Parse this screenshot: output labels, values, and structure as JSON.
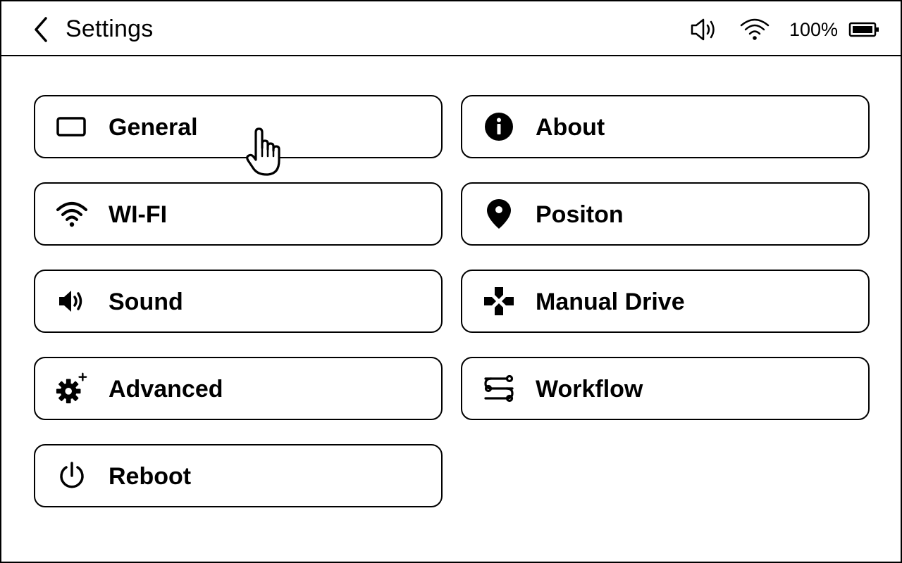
{
  "header": {
    "title": "Settings",
    "back_icon": "chevron-left-icon"
  },
  "status_bar": {
    "volume_icon": "speaker-volume-icon",
    "wifi_icon": "wifi-icon",
    "battery_percent": "100%",
    "battery_icon": "battery-full-icon"
  },
  "menu": {
    "items": [
      {
        "label": "General",
        "icon": "display-icon"
      },
      {
        "label": "About",
        "icon": "info-icon"
      },
      {
        "label": "WI-FI",
        "icon": "wifi-icon"
      },
      {
        "label": "Positon",
        "icon": "location-pin-icon"
      },
      {
        "label": "Sound",
        "icon": "speaker-icon"
      },
      {
        "label": "Manual Drive",
        "icon": "gamepad-icon"
      },
      {
        "label": "Advanced",
        "icon": "gear-plus-icon"
      },
      {
        "label": "Workflow",
        "icon": "workflow-icon"
      },
      {
        "label": "Reboot",
        "icon": "power-icon"
      }
    ]
  },
  "pointer": {
    "icon": "hand-pointer-icon"
  },
  "colors": {
    "foreground": "#000000",
    "background": "#ffffff"
  }
}
